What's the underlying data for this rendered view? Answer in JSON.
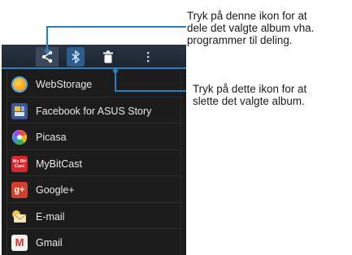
{
  "callouts": {
    "share": [
      "Tryk på denne ikon for at",
      "dele det valgte album vha.",
      "programmer til deling."
    ],
    "delete": [
      "Tryk på dette ikon for at",
      "slette det valgte album."
    ]
  },
  "actionbar": {
    "icons": [
      "share-icon",
      "bluetooth-icon",
      "trash-icon",
      "overflow-menu-icon"
    ]
  },
  "share_menu": {
    "items": [
      {
        "label": "WebStorage",
        "icon": "webstorage-icon"
      },
      {
        "label": "Facebook for ASUS Story",
        "icon": "facebook-icon"
      },
      {
        "label": "Picasa",
        "icon": "picasa-icon"
      },
      {
        "label": "MyBitCast",
        "icon": "mybitcast-icon",
        "icon_text": "My Bit Cast"
      },
      {
        "label": "Google+",
        "icon": "google-plus-icon",
        "icon_text": "g+"
      },
      {
        "label": "E-mail",
        "icon": "email-icon"
      },
      {
        "label": "Gmail",
        "icon": "gmail-icon",
        "icon_text": "M"
      }
    ]
  },
  "colors": {
    "accent": "#2b7fbf",
    "actionbar": "#222e3a",
    "menu_bg": "#1c1c1c"
  }
}
